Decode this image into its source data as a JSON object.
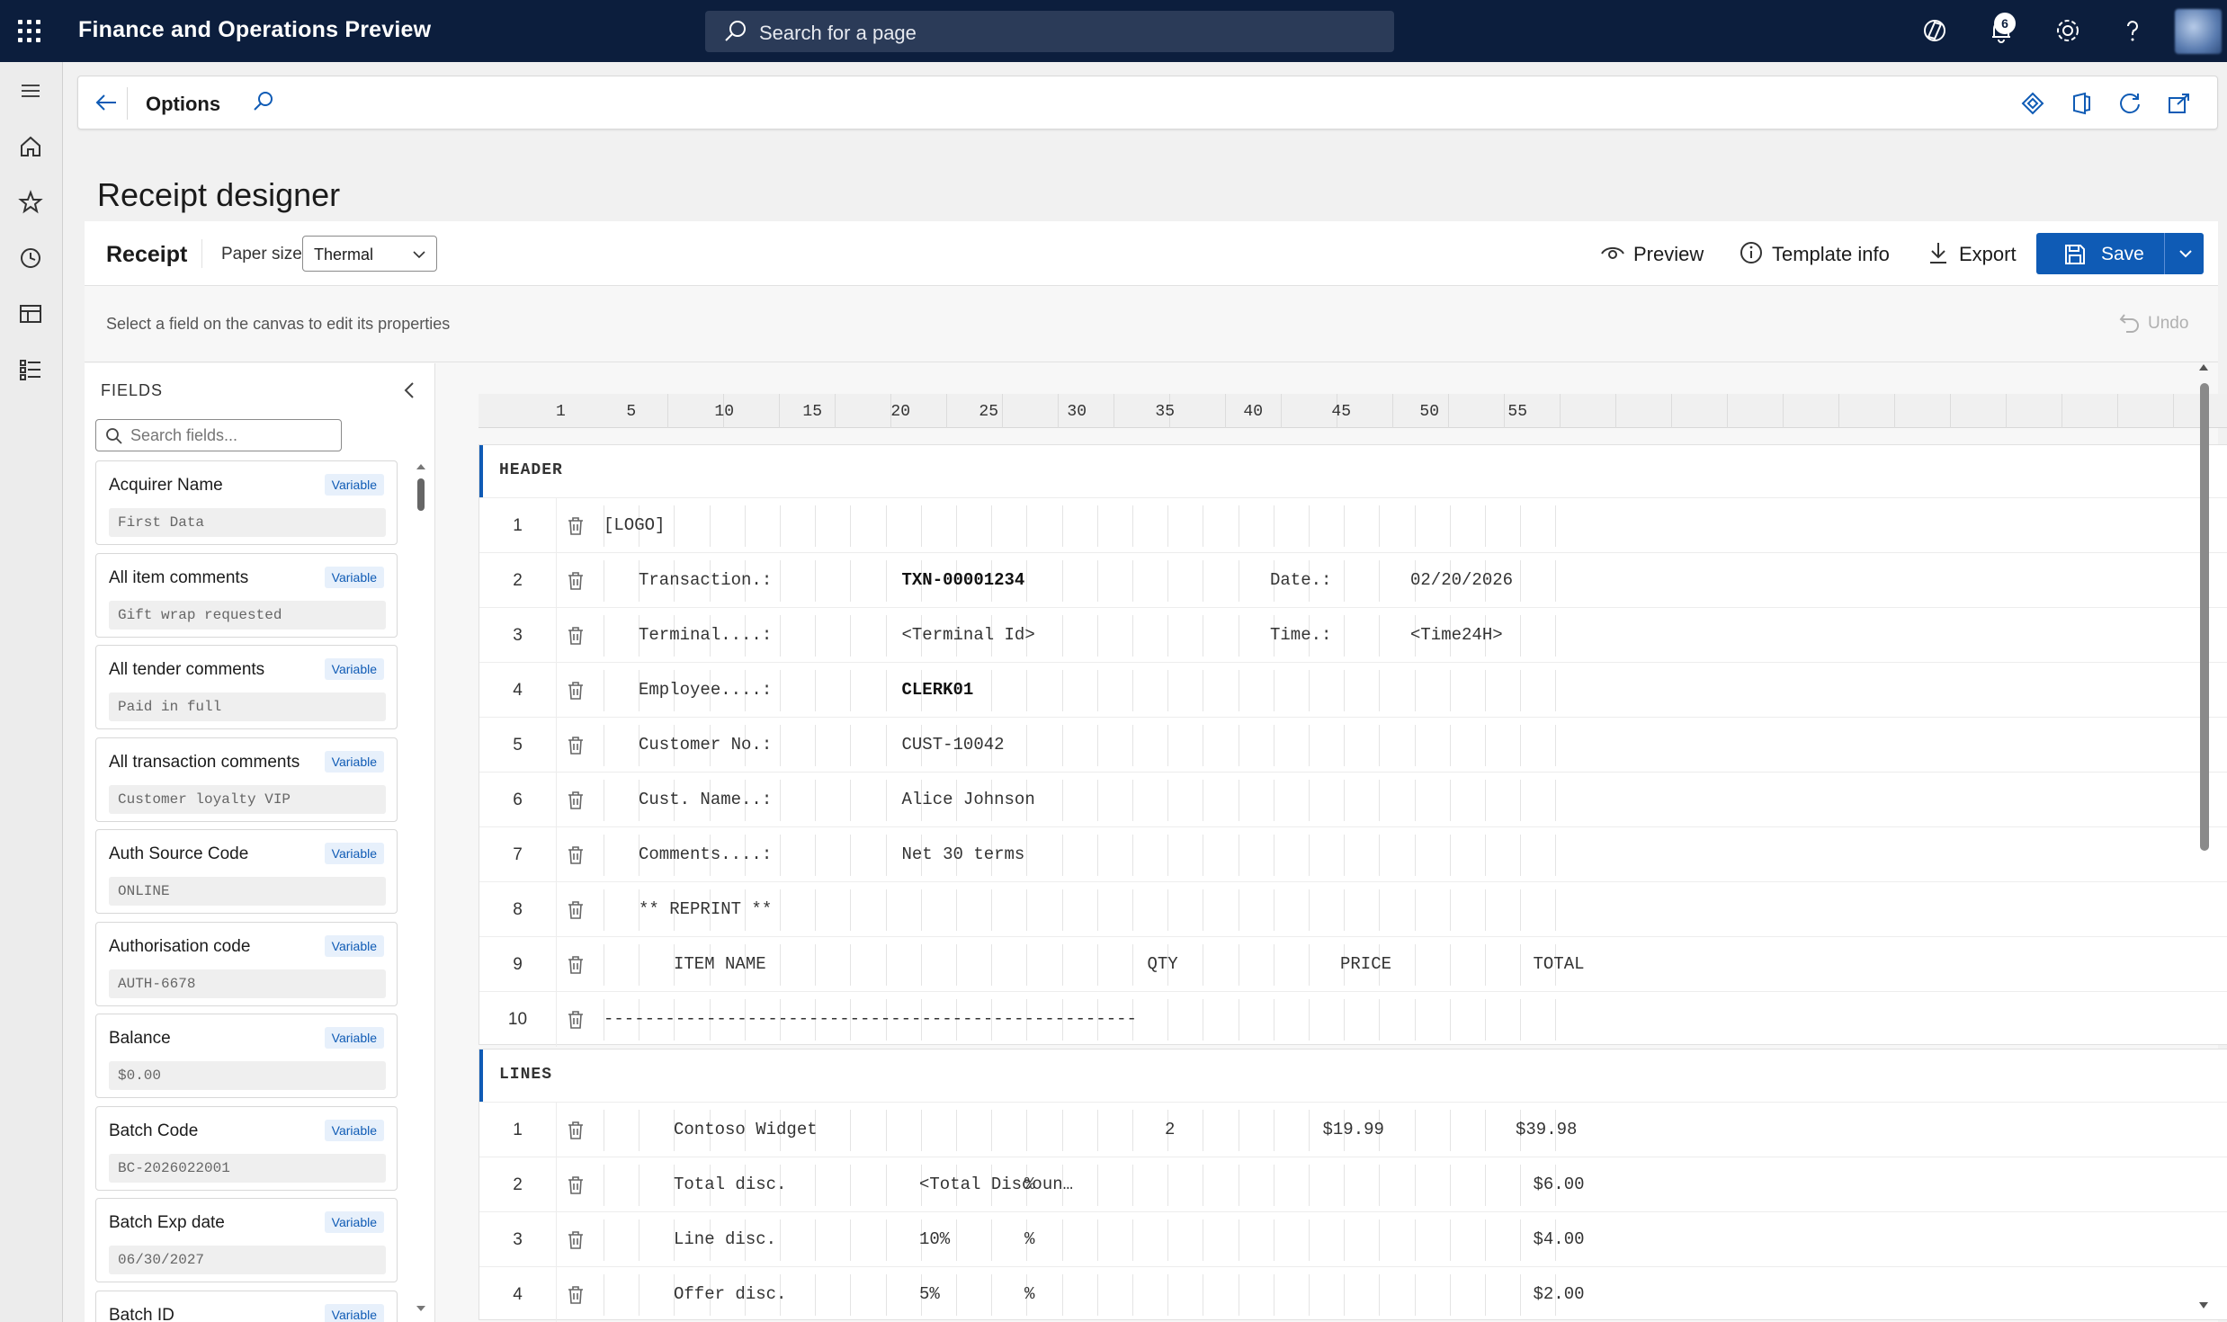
{
  "app": {
    "title": "Finance and Operations Preview",
    "search_placeholder": "Search for a page",
    "notification_count": "6"
  },
  "actionbar": {
    "title": "Options"
  },
  "page": {
    "title": "Receipt designer"
  },
  "toolbar": {
    "receipt_label": "Receipt",
    "paper_size_label": "Paper size",
    "paper_size_value": "Thermal",
    "preview_label": "Preview",
    "template_info_label": "Template info",
    "export_label": "Export",
    "save_label": "Save"
  },
  "hint": {
    "text": "Select a field on the canvas to edit its properties",
    "undo_label": "Undo"
  },
  "fields_panel": {
    "title": "FIELDS",
    "search_placeholder": "Search fields...",
    "items": [
      {
        "name": "Acquirer Name",
        "type": "Variable",
        "sample": "First Data"
      },
      {
        "name": "All item comments",
        "type": "Variable",
        "sample": "Gift wrap requested"
      },
      {
        "name": "All tender comments",
        "type": "Variable",
        "sample": "Paid in full"
      },
      {
        "name": "All transaction comments",
        "type": "Variable",
        "sample": "Customer loyalty VIP"
      },
      {
        "name": "Auth Source Code",
        "type": "Variable",
        "sample": "ONLINE"
      },
      {
        "name": "Authorisation code",
        "type": "Variable",
        "sample": "AUTH-6678"
      },
      {
        "name": "Balance",
        "type": "Variable",
        "sample": "$0.00"
      },
      {
        "name": "Batch Code",
        "type": "Variable",
        "sample": "BC-2026022001"
      },
      {
        "name": "Batch Exp date",
        "type": "Variable",
        "sample": "06/30/2027"
      },
      {
        "name": "Batch ID",
        "type": "Variable",
        "sample": ""
      }
    ]
  },
  "ruler": [
    "1",
    "5",
    "10",
    "15",
    "20",
    "25",
    "30",
    "35",
    "40",
    "45",
    "50",
    "55"
  ],
  "sections": [
    {
      "name": "HEADER",
      "rows": [
        {
          "num": "1",
          "cells": [
            {
              "text": "[LOGO]",
              "col": 0
            }
          ]
        },
        {
          "num": "2",
          "cells": [
            {
              "text": "Transaction.:",
              "col": 2
            },
            {
              "text": "TXN-00001234",
              "col": 17,
              "bold": true
            },
            {
              "text": "Date.:",
              "col": 38
            },
            {
              "text": "02/20/2026",
              "col": 46
            }
          ]
        },
        {
          "num": "3",
          "cells": [
            {
              "text": "Terminal....:",
              "col": 2
            },
            {
              "text": "<Terminal Id>",
              "col": 17
            },
            {
              "text": "Time.:",
              "col": 38
            },
            {
              "text": "<Time24H>",
              "col": 46
            }
          ]
        },
        {
          "num": "4",
          "cells": [
            {
              "text": "Employee....:",
              "col": 2
            },
            {
              "text": "CLERK01",
              "col": 17,
              "bold": true
            }
          ]
        },
        {
          "num": "5",
          "cells": [
            {
              "text": "Customer No.:",
              "col": 2
            },
            {
              "text": "CUST-10042",
              "col": 17
            }
          ]
        },
        {
          "num": "6",
          "cells": [
            {
              "text": "Cust. Name..:",
              "col": 2
            },
            {
              "text": "Alice Johnson",
              "col": 17
            }
          ]
        },
        {
          "num": "7",
          "cells": [
            {
              "text": "Comments....:",
              "col": 2
            },
            {
              "text": "Net 30 terms",
              "col": 17
            }
          ]
        },
        {
          "num": "8",
          "cells": [
            {
              "text": "** REPRINT **",
              "col": 2
            }
          ]
        },
        {
          "num": "9",
          "cells": [
            {
              "text": "ITEM NAME",
              "col": 4
            },
            {
              "text": "QTY",
              "col": 31
            },
            {
              "text": "PRICE",
              "col": 42
            },
            {
              "text": "TOTAL",
              "col": 53
            }
          ]
        },
        {
          "num": "10",
          "cells": [
            {
              "text": "----------------------------------------------------",
              "col": 0
            }
          ]
        }
      ]
    },
    {
      "name": "LINES",
      "rows": [
        {
          "num": "1",
          "cells": [
            {
              "text": "Contoso Widget",
              "col": 4
            },
            {
              "text": "2",
              "col": 32
            },
            {
              "text": "$19.99",
              "col": 41
            },
            {
              "text": "$39.98",
              "col": 52
            }
          ]
        },
        {
          "num": "2",
          "cells": [
            {
              "text": "Total disc.",
              "col": 4
            },
            {
              "text": "<Total Discoun…",
              "col": 18
            },
            {
              "text": "%",
              "col": 24
            },
            {
              "text": "$6.00",
              "col": 53
            }
          ]
        },
        {
          "num": "3",
          "cells": [
            {
              "text": "Line disc.",
              "col": 4
            },
            {
              "text": "10%",
              "col": 18
            },
            {
              "text": "%",
              "col": 24
            },
            {
              "text": "$4.00",
              "col": 53
            }
          ]
        },
        {
          "num": "4",
          "cells": [
            {
              "text": "Offer disc.",
              "col": 4
            },
            {
              "text": "5%",
              "col": 18
            },
            {
              "text": "%",
              "col": 24
            },
            {
              "text": "$2.00",
              "col": 53
            }
          ]
        }
      ]
    }
  ]
}
